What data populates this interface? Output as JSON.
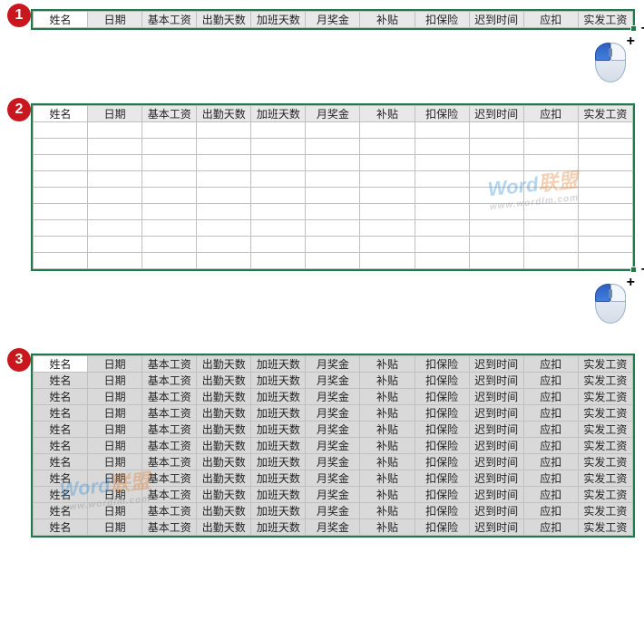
{
  "headers": [
    "姓名",
    "日期",
    "基本工资",
    "出勤天数",
    "加班天数",
    "月奖金",
    "补贴",
    "扣保险",
    "迟到时间",
    "应扣",
    "实发工资"
  ],
  "badges": {
    "s1": "1",
    "s2": "2",
    "s3": "3"
  },
  "watermark": {
    "brand": "Word",
    "cn": "联盟",
    "url": "www.wordlm.com"
  },
  "section2": {
    "emptyRows": 9
  },
  "section3": {
    "filledRows": 11
  }
}
